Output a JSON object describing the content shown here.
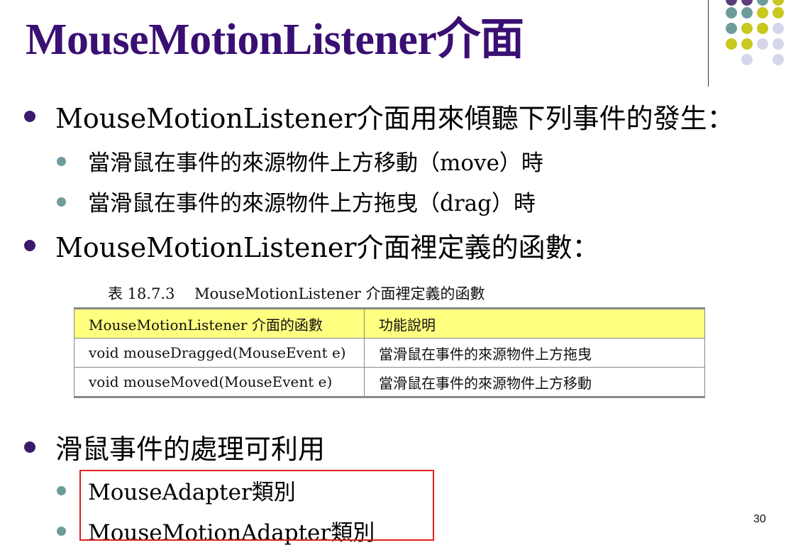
{
  "slide": {
    "title": "MouseMotionListener介面",
    "page_number": "30"
  },
  "bullets": {
    "b1": "MouseMotionListener介面用來傾聽下列事件的發生：",
    "b1_1": "當滑鼠在事件的來源物件上方移動（move）時",
    "b1_2": "當滑鼠在事件的來源物件上方拖曳（drag）時",
    "b2": "MouseMotionListener介面裡定義的函數：",
    "b3": "滑鼠事件的處理可利用",
    "b3_1": "MouseAdapter類別",
    "b3_2": "MouseMotionAdapter類別"
  },
  "table": {
    "caption": "表 18.7.3　 MouseMotionListener 介面裡定義的函數",
    "headers": [
      "MouseMotionListener 介面的函數",
      "功能說明"
    ],
    "rows": [
      [
        "void mouseDragged(MouseEvent e)",
        "當滑鼠在事件的來源物件上方拖曳"
      ],
      [
        "void mouseMoved(MouseEvent e)",
        "當滑鼠在事件的來源物件上方移動"
      ]
    ]
  },
  "colors": {
    "title": "#3a0f73",
    "header_fill": "#ffff80",
    "highlight_box": "#e02020",
    "deco_teal": "#6e9c9c",
    "deco_olive": "#c8c820",
    "deco_lavender": "#d6d6ea",
    "deco_purple": "#5c3d7c"
  }
}
